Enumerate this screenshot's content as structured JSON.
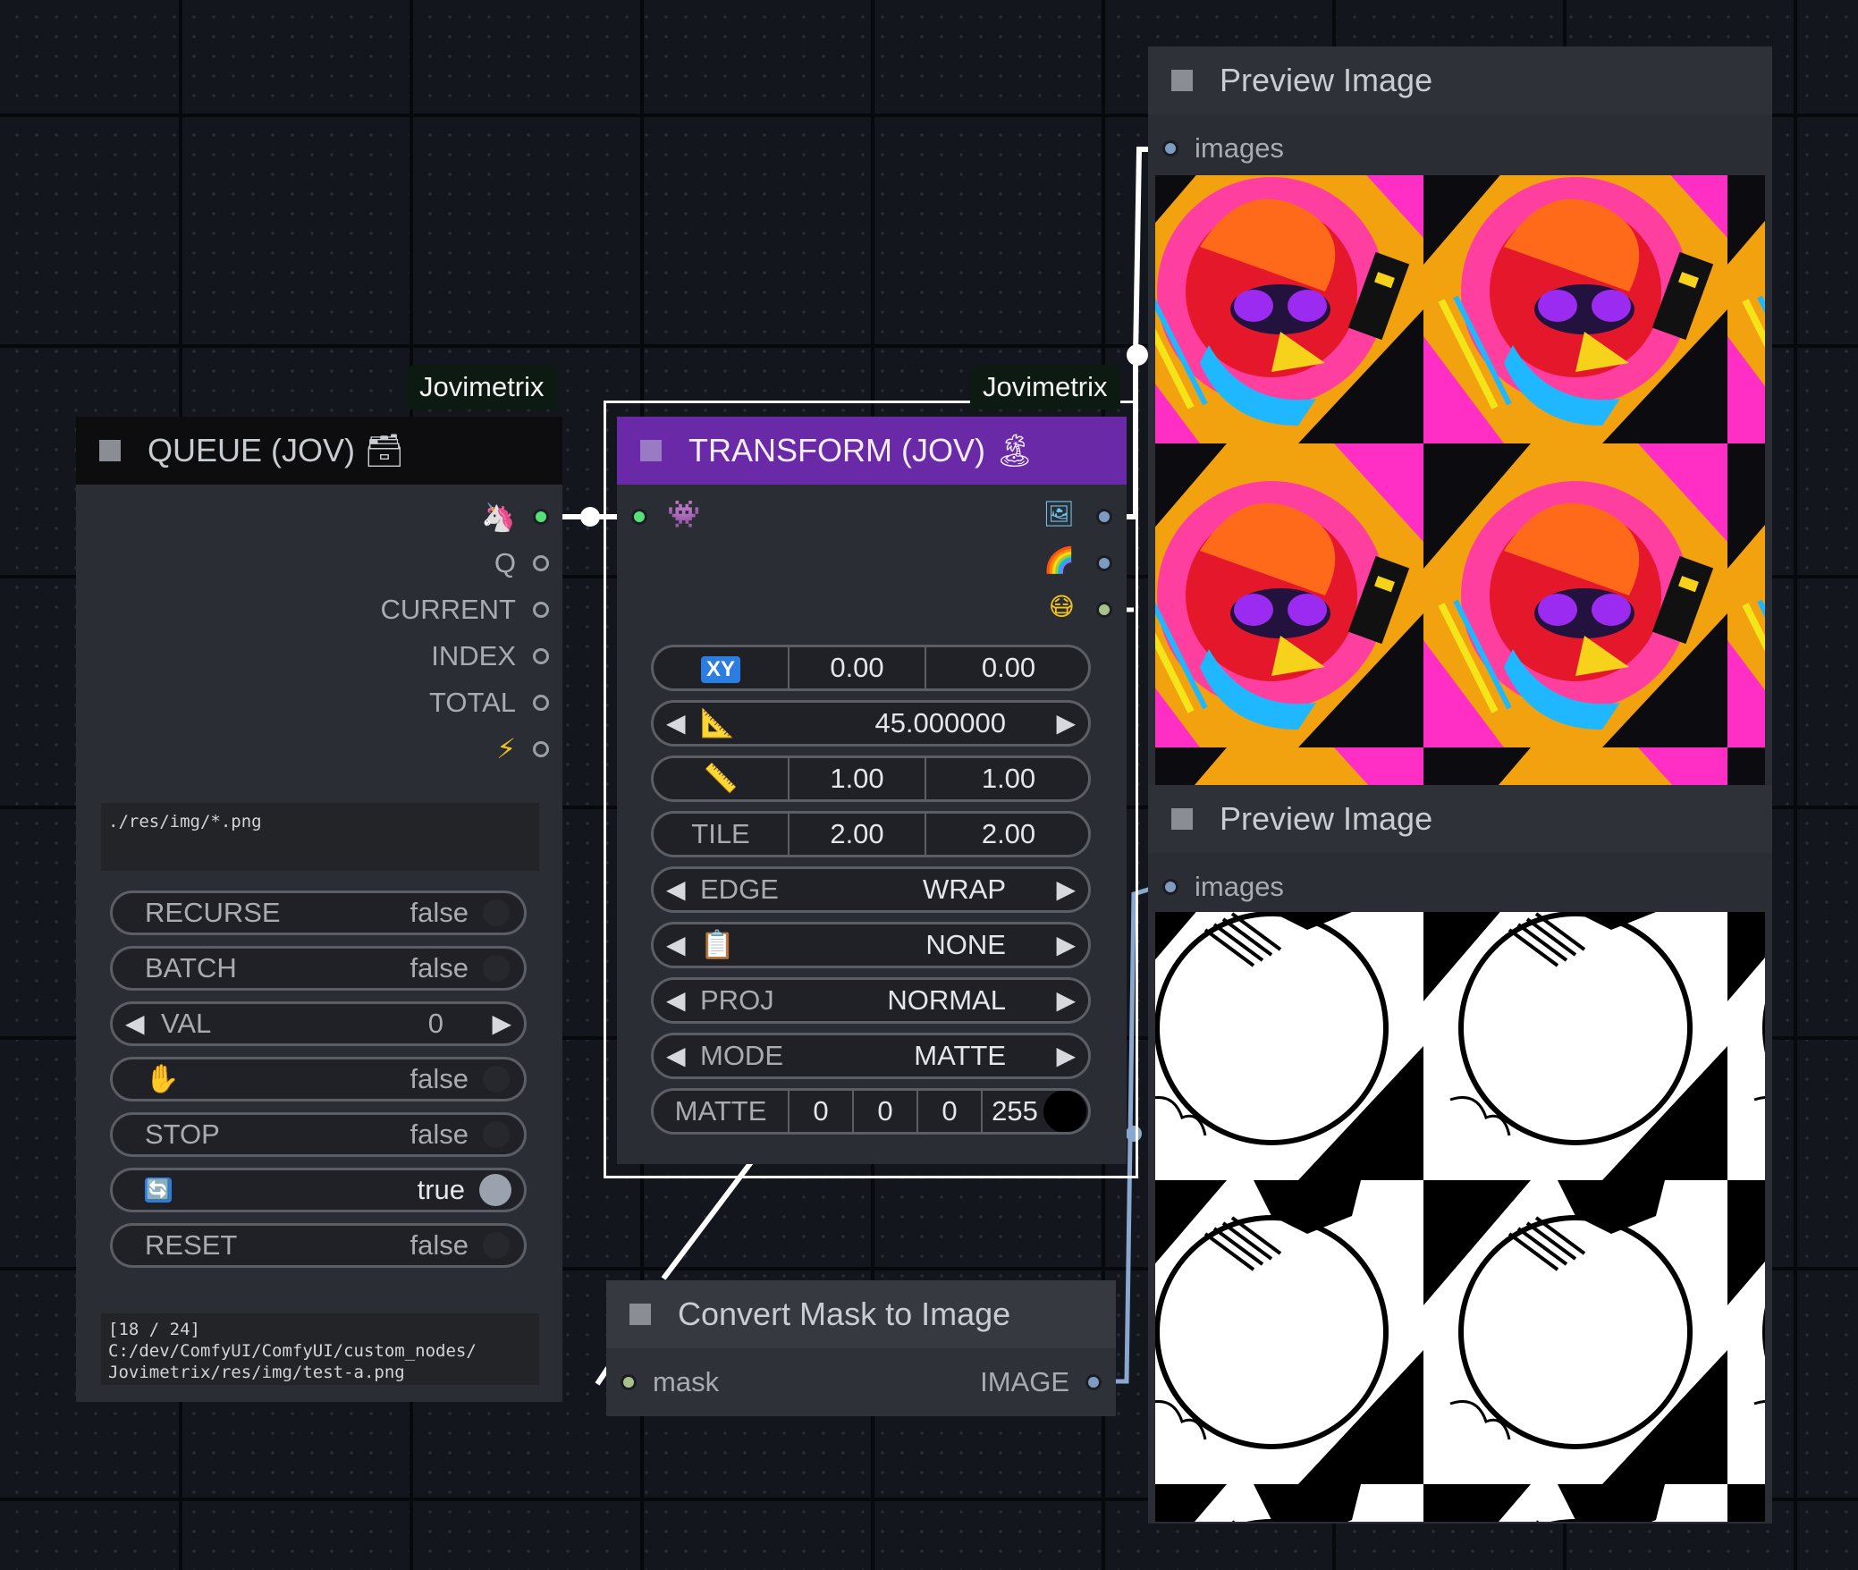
{
  "colors": {
    "canvas": "#13161c",
    "node_body": "#2a2d34",
    "transform_title_bg": "#6a2aa8",
    "queue_title_bg": "#0d0d0f",
    "green_socket": "#56e07a",
    "blue_socket": "#7e9bc2",
    "olive_socket": "#a8c08a"
  },
  "queue": {
    "badge": "Jovimetrix",
    "title": "QUEUE (JOV) 🗃",
    "outputs": [
      {
        "icon": "unicorn-icon",
        "label": "🦄"
      },
      {
        "label": "Q"
      },
      {
        "label": "CURRENT"
      },
      {
        "label": "INDEX"
      },
      {
        "label": "TOTAL"
      },
      {
        "icon": "lightning-icon",
        "label": "⚡"
      }
    ],
    "path_text": "./res/img/*.png",
    "widgets": [
      {
        "label": "RECURSE",
        "value": "false"
      },
      {
        "label": "BATCH",
        "value": "false"
      },
      {
        "label": "VAL",
        "value": "0"
      },
      {
        "label": "✋",
        "value": "false"
      },
      {
        "label": "STOP",
        "value": "false"
      },
      {
        "label": "🔄",
        "value": "true"
      },
      {
        "label": "RESET",
        "value": "false"
      }
    ],
    "status_lines": [
      "[18 / 24]",
      "C:/dev/ComfyUI/ComfyUI/custom_nodes/",
      "Jovimetrix/res/img/test-a.png"
    ]
  },
  "transform": {
    "badge": "Jovimetrix",
    "title": "TRANSFORM (JOV) 🏝",
    "input_icon": "👾",
    "outputs": [
      "🖼",
      "🌈",
      "😷"
    ],
    "widgets": {
      "offset": {
        "icon": "XY",
        "x": "0.00",
        "y": "0.00"
      },
      "angle": {
        "icon": "📐",
        "value": "45.000000"
      },
      "size": {
        "icon": "📏",
        "x": "1.00",
        "y": "1.00"
      },
      "tile": {
        "label": "TILE",
        "x": "2.00",
        "y": "2.00"
      },
      "edge": {
        "label": "EDGE",
        "value": "WRAP"
      },
      "mirror": {
        "icon": "📋",
        "value": "NONE"
      },
      "proj": {
        "label": "PROJ",
        "value": "NORMAL"
      },
      "mode": {
        "label": "MODE",
        "value": "MATTE"
      },
      "matte": {
        "label": "MATTE",
        "r": "0",
        "g": "0",
        "b": "0",
        "a": "255",
        "swatch": "#000000"
      }
    }
  },
  "convert": {
    "title": "Convert Mask to Image",
    "input": "mask",
    "output": "IMAGE"
  },
  "preview1": {
    "title": "Preview Image",
    "input": "images"
  },
  "preview2": {
    "title": "Preview Image",
    "input": "images"
  }
}
